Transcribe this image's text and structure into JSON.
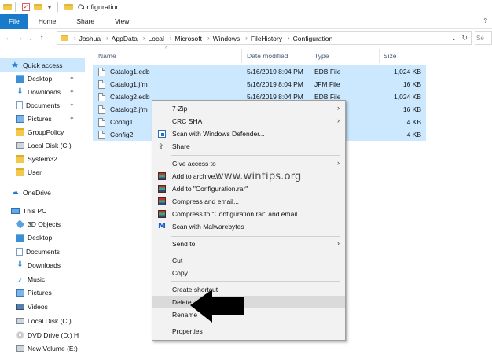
{
  "window": {
    "title": "Configuration"
  },
  "ribbon": {
    "tabs": [
      "File",
      "Home",
      "Share",
      "View"
    ],
    "help": "?"
  },
  "address": {
    "crumbs": [
      "Joshua",
      "AppData",
      "Local",
      "Microsoft",
      "Windows",
      "FileHistory",
      "Configuration"
    ],
    "search_partial": "Se"
  },
  "nav": {
    "items": [
      {
        "label": "Quick access",
        "icon": "star-icon"
      },
      {
        "label": "Desktop",
        "icon": "desktop-folder-icon"
      },
      {
        "label": "Downloads",
        "icon": "downloads-icon"
      },
      {
        "label": "Documents",
        "icon": "documents-icon"
      },
      {
        "label": "Pictures",
        "icon": "pictures-icon"
      },
      {
        "label": "GroupPolicy",
        "icon": "folder-icon"
      },
      {
        "label": "Local Disk (C:)",
        "icon": "drive-icon"
      },
      {
        "label": "System32",
        "icon": "folder-icon"
      },
      {
        "label": "User",
        "icon": "folder-icon"
      },
      {
        "label": "OneDrive",
        "icon": "cloud-icon"
      },
      {
        "label": "This PC",
        "icon": "pc-icon"
      },
      {
        "label": "3D Objects",
        "icon": "3d-objects-icon"
      },
      {
        "label": "Desktop",
        "icon": "desktop-folder-icon"
      },
      {
        "label": "Documents",
        "icon": "documents-icon"
      },
      {
        "label": "Downloads",
        "icon": "downloads-icon"
      },
      {
        "label": "Music",
        "icon": "music-icon"
      },
      {
        "label": "Pictures",
        "icon": "pictures-icon"
      },
      {
        "label": "Videos",
        "icon": "videos-icon"
      },
      {
        "label": "Local Disk (C:)",
        "icon": "drive-icon"
      },
      {
        "label": "DVD Drive (D:) H",
        "icon": "dvd-icon"
      },
      {
        "label": "New Volume (E:)",
        "icon": "drive-icon"
      }
    ]
  },
  "files": {
    "columns": [
      "Name",
      "Date modified",
      "Type",
      "Size"
    ],
    "rows": [
      {
        "name": "Catalog1.edb",
        "date": "5/16/2019 8:04 PM",
        "type": "EDB File",
        "size": "1,024 KB"
      },
      {
        "name": "Catalog1.jfm",
        "date": "5/16/2019 8:04 PM",
        "type": "JFM File",
        "size": "16 KB"
      },
      {
        "name": "Catalog2.edb",
        "date": "5/16/2019 8:04 PM",
        "type": "EDB File",
        "size": "1,024 KB"
      },
      {
        "name": "Catalog2.jfm",
        "date": "",
        "type": "",
        "size": "16 KB"
      },
      {
        "name": "Config1",
        "date": "",
        "type": "ument",
        "size": "4 KB"
      },
      {
        "name": "Config2",
        "date": "",
        "type": "ument",
        "size": "4 KB"
      }
    ]
  },
  "context_menu": {
    "items": [
      "7-Zip",
      "CRC SHA",
      "Scan with Windows Defender...",
      "Share",
      "Give access to",
      "Add to archive...",
      "Add to \"Configuration.rar\"",
      "Compress and email...",
      "Compress to \"Configuration.rar\" and email",
      "Scan with Malwarebytes",
      "Send to",
      "Cut",
      "Copy",
      "Create shortcut",
      "Delete",
      "Rename",
      "Properties"
    ]
  },
  "watermark": "www.wintips.org",
  "colors": {
    "selection": "#cce8ff",
    "file_tab": "#1979ca",
    "menu_bg": "#f2f2f2",
    "menu_highlight": "#dadada"
  }
}
